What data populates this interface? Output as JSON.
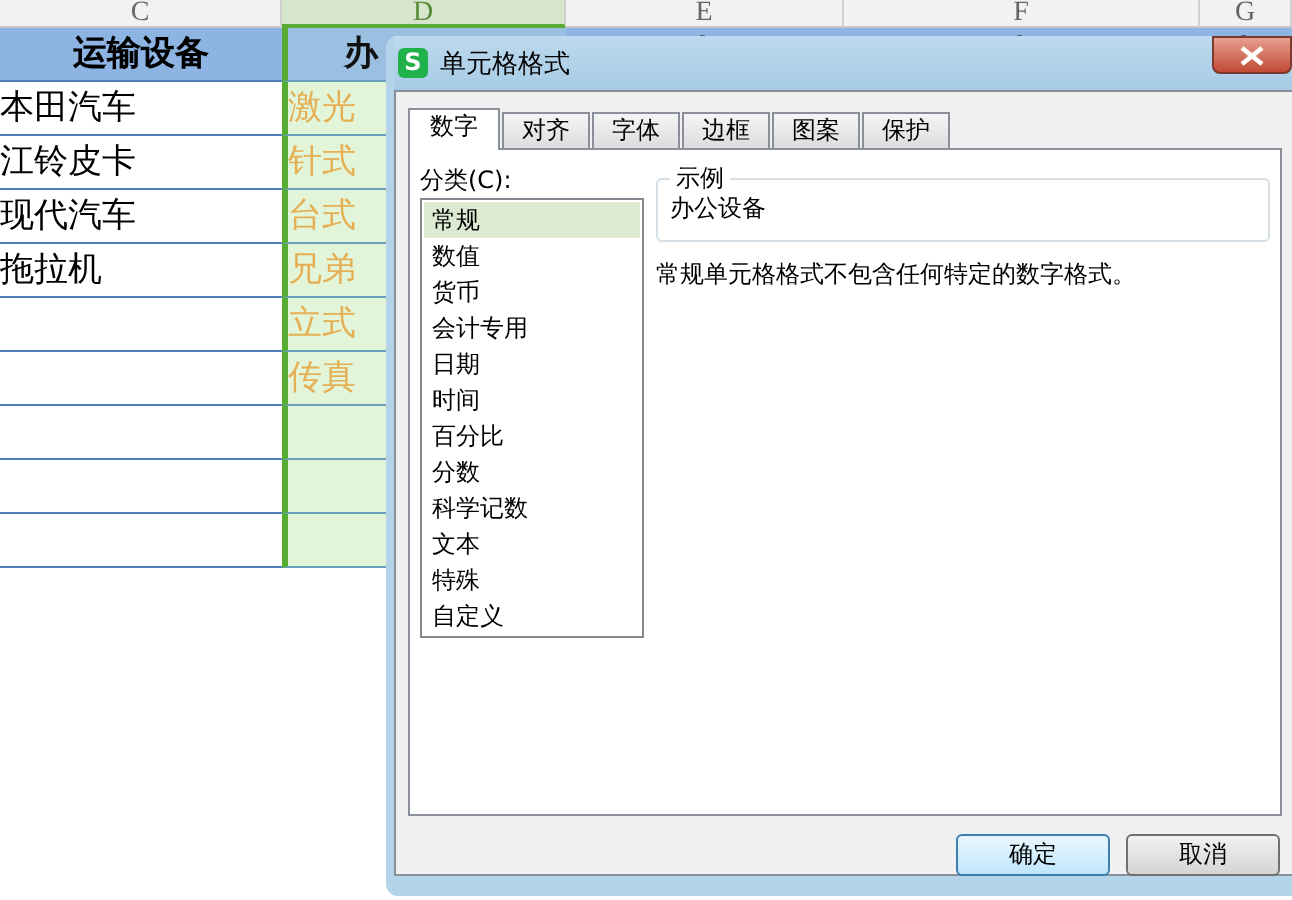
{
  "sheet": {
    "column_headers": [
      {
        "label": "C",
        "selected": false
      },
      {
        "label": "D",
        "selected": true
      },
      {
        "label": "E",
        "selected": false
      },
      {
        "label": "F",
        "selected": false
      },
      {
        "label": "G",
        "selected": false
      }
    ],
    "column_c": {
      "header": "运输设备",
      "cells": [
        "本田汽车",
        "江铃皮卡",
        "现代汽车",
        "拖拉机"
      ]
    },
    "column_d": {
      "header": "办",
      "cells": [
        "激光",
        "针式",
        "台式",
        "兄弟",
        "立式",
        "传真"
      ]
    }
  },
  "dialog": {
    "app_icon": "S",
    "title": "单元格格式",
    "tabs": [
      {
        "label": "数字",
        "selected": true
      },
      {
        "label": "对齐",
        "selected": false
      },
      {
        "label": "字体",
        "selected": false
      },
      {
        "label": "边框",
        "selected": false
      },
      {
        "label": "图案",
        "selected": false
      },
      {
        "label": "保护",
        "selected": false
      }
    ],
    "category_label": "分类(C):",
    "categories": [
      {
        "label": "常规",
        "selected": true
      },
      {
        "label": "数值",
        "selected": false
      },
      {
        "label": "货币",
        "selected": false
      },
      {
        "label": "会计专用",
        "selected": false
      },
      {
        "label": "日期",
        "selected": false
      },
      {
        "label": "时间",
        "selected": false
      },
      {
        "label": "百分比",
        "selected": false
      },
      {
        "label": "分数",
        "selected": false
      },
      {
        "label": "科学记数",
        "selected": false
      },
      {
        "label": "文本",
        "selected": false
      },
      {
        "label": "特殊",
        "selected": false
      },
      {
        "label": "自定义",
        "selected": false
      }
    ],
    "sample": {
      "legend": "示例",
      "value": "办公设备"
    },
    "description": "常规单元格格式不包含任何特定的数字格式。",
    "buttons": [
      {
        "label": "确定",
        "default": true
      },
      {
        "label": "取消",
        "default": false
      }
    ]
  }
}
